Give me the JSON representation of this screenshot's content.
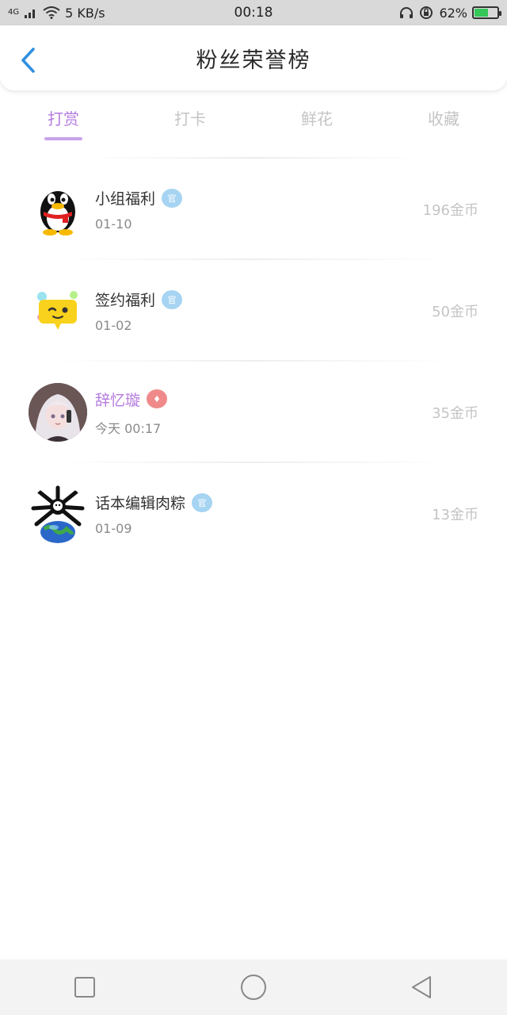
{
  "status_bar": {
    "network_type": "4G",
    "speed": "5 KB/s",
    "time": "00:18",
    "battery_percent": "62%",
    "battery_level": 0.62,
    "icons": [
      "signal-icon",
      "wifi-icon",
      "headphones-icon",
      "alarm-icon",
      "battery-icon"
    ]
  },
  "header": {
    "title": "粉丝荣誉榜",
    "back_icon": "chevron-left-icon"
  },
  "tabs": [
    {
      "label": "打赏",
      "active": true
    },
    {
      "label": "打卡",
      "active": false
    },
    {
      "label": "鲜花",
      "active": false
    },
    {
      "label": "收藏",
      "active": false
    }
  ],
  "colors": {
    "accent": "#b57be0",
    "back_icon": "#2f8fe0",
    "official_badge": "#a6d4f2",
    "vip_badge": "#f08a8a"
  },
  "fans": [
    {
      "name": "小组福利",
      "badge": "官",
      "badge_type": "official",
      "date": "01-10",
      "coins": "196金币",
      "avatar": "penguin-avatar"
    },
    {
      "name": "签约福利",
      "badge": "官",
      "badge_type": "official",
      "date": "01-02",
      "coins": "50金币",
      "avatar": "wink-emoji-avatar"
    },
    {
      "name": "辞忆璇",
      "badge": "♦",
      "badge_type": "vip",
      "date": "今天 00:17",
      "coins": "35金币",
      "avatar": "anime-girl-avatar"
    },
    {
      "name": "话本编辑肉粽",
      "badge": "官",
      "badge_type": "official",
      "date": "01-09",
      "coins": "13金币",
      "avatar": "earth-character-avatar"
    }
  ],
  "nav": {
    "icons": [
      "recents-square-icon",
      "home-circle-icon",
      "back-triangle-icon"
    ]
  }
}
